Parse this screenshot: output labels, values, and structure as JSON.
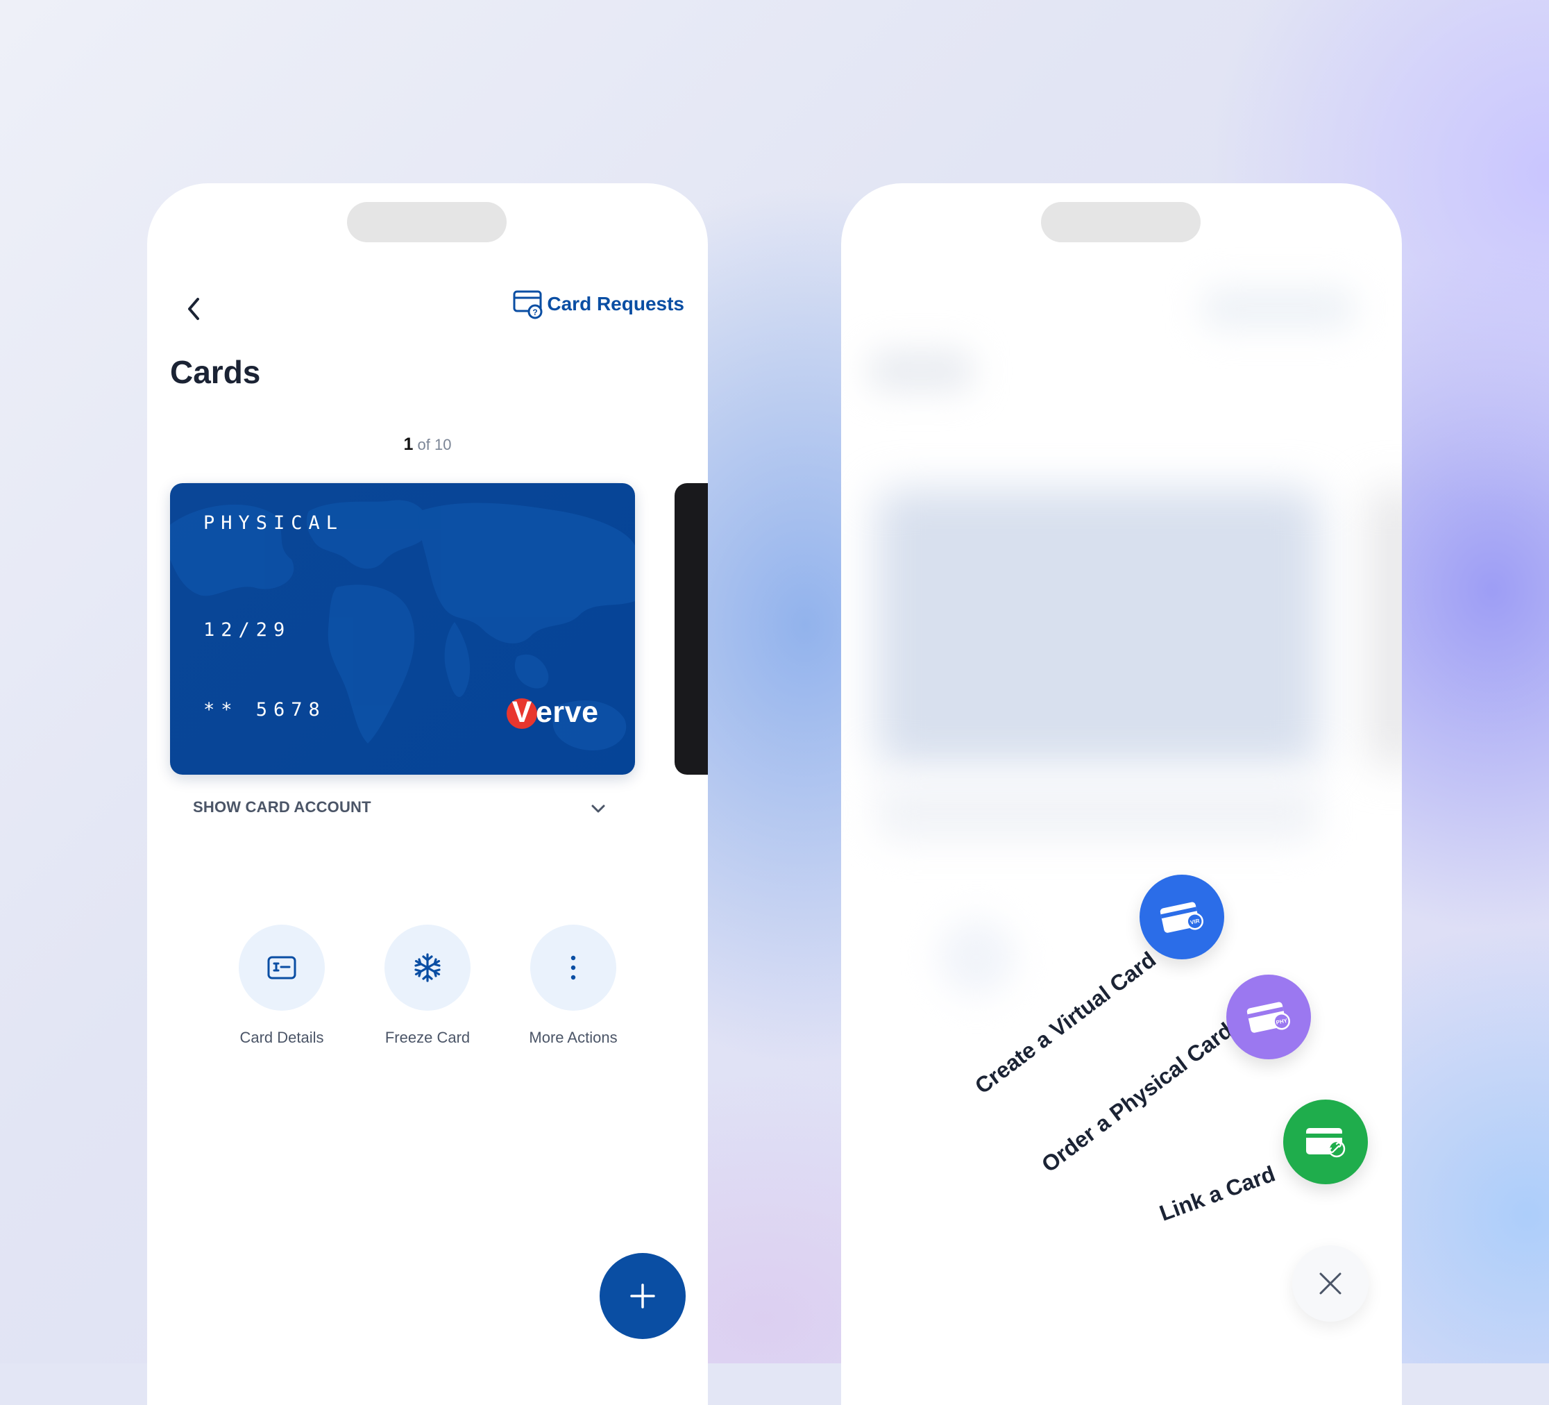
{
  "left_screen": {
    "header": {
      "card_requests_label": "Card Requests"
    },
    "title": "Cards",
    "pager": {
      "current": "1",
      "total_text": "of 10"
    },
    "card": {
      "type": "PHYSICAL",
      "expiry": "12/29",
      "number": "** 5678",
      "brand_v": "V",
      "brand_rest": "erve",
      "color": "#0a4697"
    },
    "show_card_account": "SHOW CARD ACCOUNT",
    "actions": [
      {
        "label": "Card Details",
        "icon": "card-details-icon"
      },
      {
        "label": "Freeze Card",
        "icon": "snowflake-icon"
      },
      {
        "label": "More Actions",
        "icon": "more-vertical-icon"
      }
    ],
    "fab_icon": "plus-icon"
  },
  "right_screen": {
    "menu": [
      {
        "label": "Create a Virtual Card",
        "badge": "VIR",
        "color": "#2b6de8"
      },
      {
        "label": "Order a Physical Card",
        "badge": "PHY",
        "color": "#9b78f0"
      },
      {
        "label": "Link a Card",
        "badge": "",
        "color": "#1fad4c"
      }
    ],
    "close_icon": "close-icon"
  },
  "colors": {
    "primary": "#0a4ea3",
    "text_dark": "#1b2334",
    "text_muted": "#4b5567"
  }
}
